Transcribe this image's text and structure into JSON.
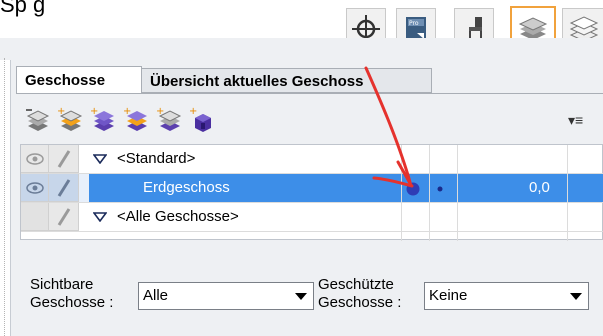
{
  "caption": "Sp                    g",
  "tabs": {
    "floors": "Geschosse",
    "overview": "Übersicht aktuelles Geschoss"
  },
  "floors": [
    {
      "label": "<Standard>"
    },
    {
      "label": "Erdgeschoss",
      "value": "0,0",
      "selected": true
    },
    {
      "label": "<Alle Geschosse>"
    }
  ],
  "controls": {
    "visible_label_line1": "Sichtbare",
    "visible_label_line2": "Geschosse :",
    "visible_value": "Alle",
    "protected_label_line1": "Geschützte",
    "protected_label_line2": "Geschosse :",
    "protected_value": "Keine"
  },
  "icons": {
    "toolbar": [
      "crosshair-icon",
      "pro-icon",
      "chair-icon",
      "floors-stack-icon",
      "layers-icon"
    ],
    "floor_actions": [
      "floor-delete-icon",
      "floor-add-above-icon",
      "floor-add-below-icon",
      "floor-add-icon",
      "floor-insert-icon",
      "floor-3d-icon"
    ]
  },
  "colors": {
    "selection": "#3d8ee8",
    "annotation_arrow": "#e5322d",
    "active_tab_border": "#f1a23c"
  }
}
